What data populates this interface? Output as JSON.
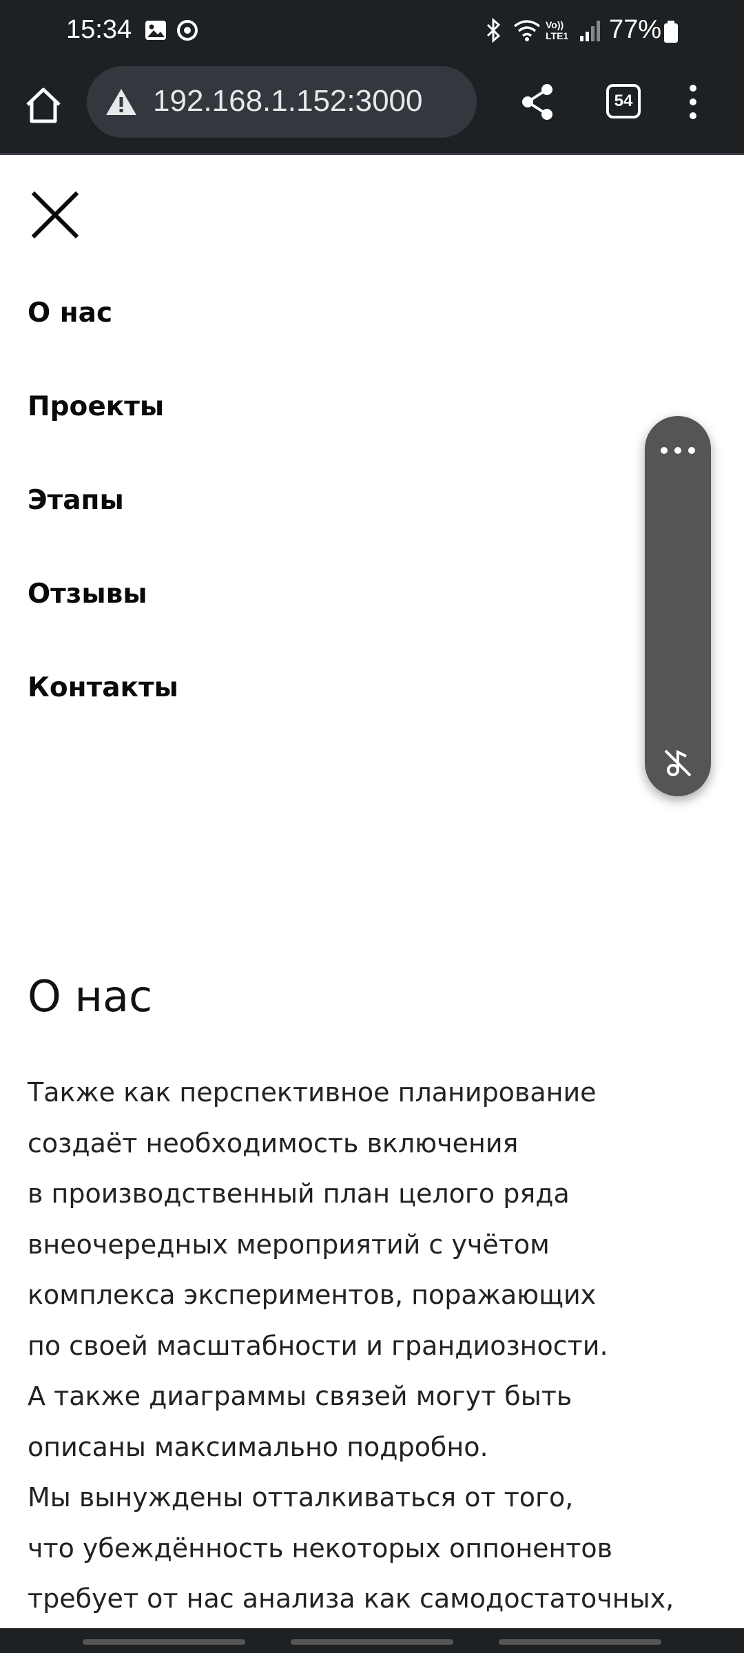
{
  "status_bar": {
    "time": "15:34",
    "battery_percent": "77%",
    "network_label": "Vo)) LTE1",
    "icons": [
      "image-icon",
      "sync-icon",
      "bluetooth-icon",
      "wifi-icon",
      "signal-icon",
      "battery-icon"
    ]
  },
  "browser": {
    "url": "192.168.1.152:3000",
    "tab_count": "54"
  },
  "nav": {
    "items": [
      {
        "label": "О нас"
      },
      {
        "label": "Проекты"
      },
      {
        "label": "Этапы"
      },
      {
        "label": "Отзывы"
      },
      {
        "label": "Контакты"
      }
    ]
  },
  "about": {
    "title": "О нас",
    "lines": [
      "Также как перспективное планирование",
      "создаёт необходимость включения",
      "в производственный план целого ряда",
      "внеочередных мероприятий с учётом",
      "комплекса экспериментов, поражающих",
      "по своей масштабности и грандиозности.",
      "А также диаграммы связей могут быть",
      "описаны максимально подробно.",
      "Мы вынуждены отталкиваться от того,",
      "что убеждённость некоторых оппонентов",
      "требует от нас анализа как самодостаточных,"
    ]
  },
  "colors": {
    "chrome_bg": "#1e2124",
    "panel_bg": "#555555"
  }
}
